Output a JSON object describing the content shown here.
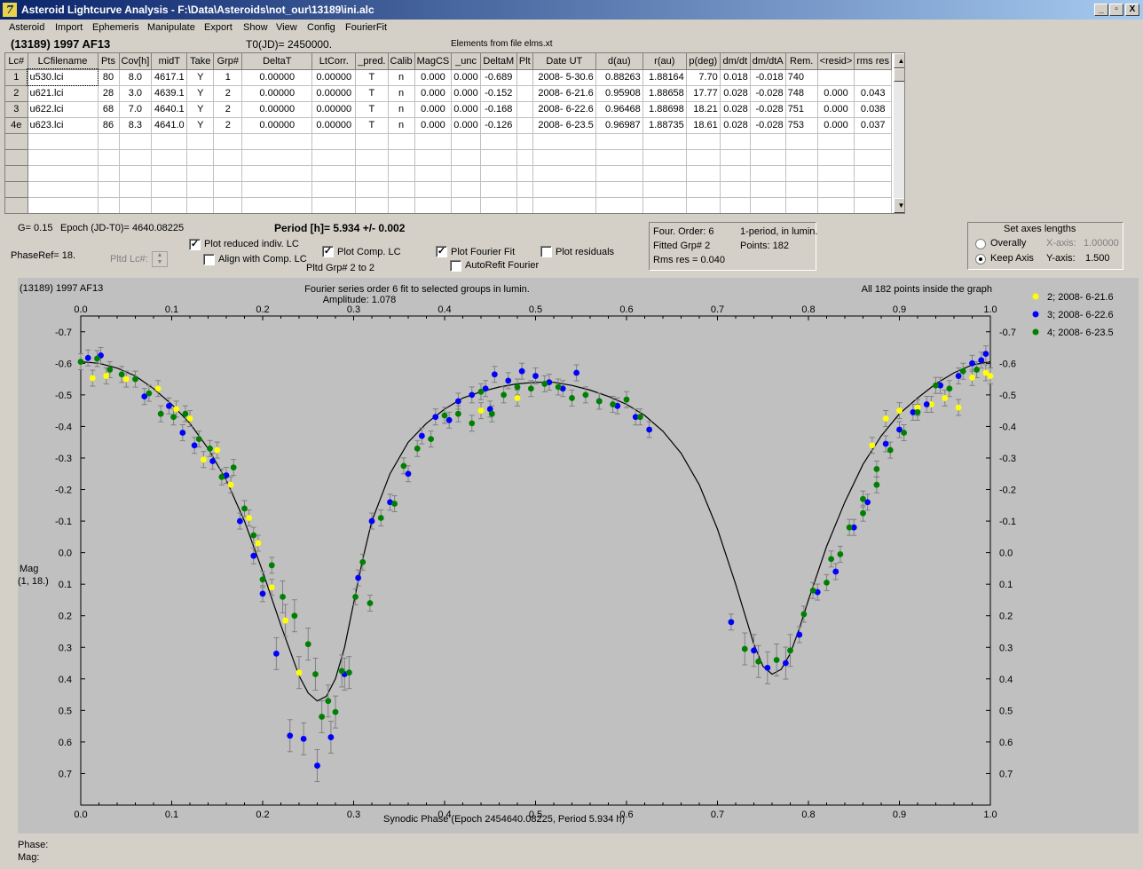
{
  "window": {
    "title": "Asteroid Lightcurve Analysis - F:\\Data\\Asteroids\\not_our\\13189\\ini.alc",
    "app_icon_glyph": "7",
    "controls": [
      "_",
      "▫",
      "X"
    ]
  },
  "menu": [
    "Asteroid",
    "Import",
    "Ephemeris",
    "Manipulate",
    "Export",
    "Show",
    "View",
    "Config",
    "FourierFit"
  ],
  "header": {
    "asteroid": "(13189) 1997 AF13",
    "t0": "T0(JD)= 2450000.",
    "elements": "Elements from file elms.xt"
  },
  "table": {
    "columns": [
      "Lc#",
      "LCfilename",
      "Pts",
      "Cov[h]",
      "midT",
      "Take",
      "Grp#",
      "DeltaT",
      "LtCorr.",
      "_pred.",
      "Calib",
      "MagCS",
      "_unc",
      "DeltaM",
      "Plt",
      "Date UT",
      "d(au)",
      "r(au)",
      "p(deg)",
      "dm/dt",
      "dm/dtA",
      "Rem.",
      "<resid>",
      "rms res"
    ],
    "rows": [
      [
        "1",
        "u530.lci",
        "80",
        "8.0",
        "4617.1",
        "Y",
        "1",
        "0.00000",
        "0.00000",
        "T",
        "n",
        "0.000",
        "0.000",
        "-0.689",
        "",
        "2008- 5-30.6",
        "0.88263",
        "1.88164",
        "7.70",
        "0.018",
        "-0.018",
        "740",
        "",
        ""
      ],
      [
        "2",
        "u621.lci",
        "28",
        "3.0",
        "4639.1",
        "Y",
        "2",
        "0.00000",
        "0.00000",
        "T",
        "n",
        "0.000",
        "0.000",
        "-0.152",
        "",
        "2008- 6-21.6",
        "0.95908",
        "1.88658",
        "17.77",
        "0.028",
        "-0.028",
        "748",
        "0.000",
        "0.043"
      ],
      [
        "3",
        "u622.lci",
        "68",
        "7.0",
        "4640.1",
        "Y",
        "2",
        "0.00000",
        "0.00000",
        "T",
        "n",
        "0.000",
        "0.000",
        "-0.168",
        "",
        "2008- 6-22.6",
        "0.96468",
        "1.88698",
        "18.21",
        "0.028",
        "-0.028",
        "751",
        "0.000",
        "0.038"
      ],
      [
        "4e",
        "u623.lci",
        "86",
        "8.3",
        "4641.0",
        "Y",
        "2",
        "0.00000",
        "0.00000",
        "T",
        "n",
        "0.000",
        "0.000",
        "-0.126",
        "",
        "2008- 6-23.5",
        "0.96987",
        "1.88735",
        "18.61",
        "0.028",
        "-0.028",
        "753",
        "0.000",
        "0.037"
      ]
    ],
    "empty_rows": 5
  },
  "controls": {
    "g_value": "G= 0.15",
    "epoch": "Epoch (JD-T0)= 4640.08225",
    "period": "Period [h]= 5.934 +/- 0.002",
    "phase_ref": "PhaseRef= 18.",
    "pltd_lc": "Pltd Lc#:",
    "pltd_grp": "Pltd Grp#  2  to  2",
    "plot_reduced": "Plot reduced indiv. LC",
    "align_comp": "Align with Comp. LC",
    "plot_comp": "Plot Comp. LC",
    "plot_fourier": "Plot Fourier Fit",
    "autorefit": "AutoRefit Fourier",
    "plot_residuals": "Plot residuals",
    "checked_mark": "✓",
    "plot_reduced_checked": true,
    "align_comp_checked": false,
    "plot_comp_checked": true,
    "plot_fourier_checked": true,
    "autorefit_checked": false,
    "plot_residuals_checked": false
  },
  "fit_info": {
    "four_order": "Four. Order:  6",
    "period_mode": "1-period, in lumin.",
    "fitted_grp": "Fitted Grp# 2",
    "points": "Points: 182",
    "rms": "Rms res     = 0.040"
  },
  "axes_box": {
    "title": "Set axes lengths",
    "overally": "Overally",
    "keep_axis": "Keep Axis",
    "x_label": "X-axis:",
    "x_value": "1.00000",
    "y_label": "Y-axis:",
    "y_value": "1.500",
    "selected": "Keep Axis"
  },
  "status": {
    "phase": "Phase:",
    "mag": "Mag:"
  },
  "chart_data": {
    "type": "scatter",
    "title_left": "(13189) 1997 AF13",
    "title_center": "Fourier series order 6 fit to selected groups in lumin.",
    "amplitude": "Amplitude: 1.078",
    "title_right": "All 182 points inside the graph",
    "xlabel": "Synodic Phase (Epoch 2454640.08225, Period 5.934 h)",
    "ylabel": "Mag",
    "ylabel2": "(1, 18.)",
    "xlim": [
      0,
      1
    ],
    "ylim": [
      -0.75,
      0.8
    ],
    "y_inverted": true,
    "x_ticks": [
      "0.0",
      "0.1",
      "0.2",
      "0.3",
      "0.4",
      "0.5",
      "0.6",
      "0.7",
      "0.8",
      "0.9",
      "1.0"
    ],
    "y_ticks": [
      "-0.7",
      "-0.6",
      "-0.5",
      "-0.4",
      "-0.3",
      "-0.2",
      "-0.1",
      "0.0",
      "0.1",
      "0.2",
      "0.3",
      "0.4",
      "0.5",
      "0.6",
      "0.7"
    ],
    "plot_bg": "#c0c0c0",
    "series": [
      {
        "name": "2; 2008- 6-21.6",
        "color": "#ffff00",
        "points": [
          [
            0.013,
            -0.553
          ],
          [
            0.028,
            -0.56
          ],
          [
            0.05,
            -0.55
          ],
          [
            0.085,
            -0.52
          ],
          [
            0.105,
            -0.455
          ],
          [
            0.12,
            -0.425
          ],
          [
            0.135,
            -0.295
          ],
          [
            0.15,
            -0.325
          ],
          [
            0.165,
            -0.215
          ],
          [
            0.185,
            -0.11
          ],
          [
            0.195,
            -0.03
          ],
          [
            0.21,
            0.11
          ],
          [
            0.225,
            0.215
          ],
          [
            0.24,
            0.38
          ],
          [
            0.885,
            -0.425
          ],
          [
            0.9,
            -0.45
          ],
          [
            0.92,
            -0.46
          ],
          [
            0.935,
            -0.47
          ],
          [
            0.95,
            -0.49
          ],
          [
            0.965,
            -0.46
          ],
          [
            0.98,
            -0.555
          ],
          [
            0.995,
            -0.57
          ],
          [
            1.0,
            -0.56
          ],
          [
            0.44,
            -0.45
          ],
          [
            0.87,
            -0.34
          ],
          [
            0.48,
            -0.49
          ]
        ]
      },
      {
        "name": "3; 2008- 6-22.6",
        "color": "#0000ff",
        "points": [
          [
            0.008,
            -0.617
          ],
          [
            0.022,
            -0.625
          ],
          [
            0.07,
            -0.495
          ],
          [
            0.097,
            -0.465
          ],
          [
            0.112,
            -0.38
          ],
          [
            0.125,
            -0.34
          ],
          [
            0.145,
            -0.29
          ],
          [
            0.16,
            -0.245
          ],
          [
            0.175,
            -0.1
          ],
          [
            0.19,
            0.01
          ],
          [
            0.2,
            0.13
          ],
          [
            0.215,
            0.32
          ],
          [
            0.23,
            0.58
          ],
          [
            0.245,
            0.59
          ],
          [
            0.26,
            0.675
          ],
          [
            0.275,
            0.585
          ],
          [
            0.29,
            0.385
          ],
          [
            0.305,
            0.08
          ],
          [
            0.32,
            -0.1
          ],
          [
            0.34,
            -0.16
          ],
          [
            0.36,
            -0.25
          ],
          [
            0.375,
            -0.37
          ],
          [
            0.39,
            -0.43
          ],
          [
            0.405,
            -0.42
          ],
          [
            0.415,
            -0.48
          ],
          [
            0.43,
            -0.5
          ],
          [
            0.445,
            -0.52
          ],
          [
            0.455,
            -0.565
          ],
          [
            0.47,
            -0.545
          ],
          [
            0.485,
            -0.575
          ],
          [
            0.5,
            -0.56
          ],
          [
            0.515,
            -0.54
          ],
          [
            0.53,
            -0.52
          ],
          [
            0.545,
            -0.57
          ],
          [
            0.57,
            -0.48
          ],
          [
            0.59,
            -0.465
          ],
          [
            0.61,
            -0.43
          ],
          [
            0.625,
            -0.39
          ],
          [
            0.715,
            0.22
          ],
          [
            0.74,
            0.31
          ],
          [
            0.755,
            0.365
          ],
          [
            0.775,
            0.35
          ],
          [
            0.79,
            0.26
          ],
          [
            0.81,
            0.125
          ],
          [
            0.83,
            0.06
          ],
          [
            0.85,
            -0.08
          ],
          [
            0.865,
            -0.16
          ],
          [
            0.885,
            -0.345
          ],
          [
            0.9,
            -0.39
          ],
          [
            0.915,
            -0.445
          ],
          [
            0.93,
            -0.47
          ],
          [
            0.945,
            -0.53
          ],
          [
            0.965,
            -0.56
          ],
          [
            0.98,
            -0.6
          ],
          [
            0.995,
            -0.63
          ],
          [
            0.99,
            -0.61
          ],
          [
            0.45,
            -0.455
          ]
        ]
      },
      {
        "name": "4; 2008- 6-23.5",
        "color": "#008000",
        "points": [
          [
            0.0,
            -0.605
          ],
          [
            0.018,
            -0.615
          ],
          [
            0.032,
            -0.58
          ],
          [
            0.045,
            -0.565
          ],
          [
            0.06,
            -0.55
          ],
          [
            0.075,
            -0.505
          ],
          [
            0.088,
            -0.44
          ],
          [
            0.102,
            -0.43
          ],
          [
            0.115,
            -0.44
          ],
          [
            0.13,
            -0.36
          ],
          [
            0.142,
            -0.33
          ],
          [
            0.155,
            -0.24
          ],
          [
            0.168,
            -0.27
          ],
          [
            0.18,
            -0.14
          ],
          [
            0.19,
            -0.055
          ],
          [
            0.2,
            0.085
          ],
          [
            0.21,
            0.04
          ],
          [
            0.222,
            0.14
          ],
          [
            0.235,
            0.2
          ],
          [
            0.25,
            0.29
          ],
          [
            0.258,
            0.385
          ],
          [
            0.265,
            0.52
          ],
          [
            0.272,
            0.47
          ],
          [
            0.28,
            0.505
          ],
          [
            0.287,
            0.375
          ],
          [
            0.295,
            0.38
          ],
          [
            0.302,
            0.14
          ],
          [
            0.31,
            0.03
          ],
          [
            0.318,
            0.16
          ],
          [
            0.33,
            -0.11
          ],
          [
            0.345,
            -0.155
          ],
          [
            0.355,
            -0.275
          ],
          [
            0.37,
            -0.33
          ],
          [
            0.385,
            -0.36
          ],
          [
            0.4,
            -0.435
          ],
          [
            0.415,
            -0.44
          ],
          [
            0.43,
            -0.41
          ],
          [
            0.44,
            -0.51
          ],
          [
            0.452,
            -0.44
          ],
          [
            0.465,
            -0.5
          ],
          [
            0.48,
            -0.525
          ],
          [
            0.495,
            -0.52
          ],
          [
            0.51,
            -0.535
          ],
          [
            0.525,
            -0.525
          ],
          [
            0.54,
            -0.49
          ],
          [
            0.555,
            -0.5
          ],
          [
            0.57,
            -0.48
          ],
          [
            0.585,
            -0.47
          ],
          [
            0.6,
            -0.485
          ],
          [
            0.615,
            -0.43
          ],
          [
            0.73,
            0.305
          ],
          [
            0.745,
            0.345
          ],
          [
            0.765,
            0.34
          ],
          [
            0.78,
            0.31
          ],
          [
            0.795,
            0.195
          ],
          [
            0.805,
            0.12
          ],
          [
            0.82,
            0.095
          ],
          [
            0.835,
            0.005
          ],
          [
            0.845,
            -0.08
          ],
          [
            0.86,
            -0.125
          ],
          [
            0.875,
            -0.215
          ],
          [
            0.89,
            -0.325
          ],
          [
            0.905,
            -0.38
          ],
          [
            0.92,
            -0.445
          ],
          [
            0.94,
            -0.53
          ],
          [
            0.955,
            -0.52
          ],
          [
            0.97,
            -0.575
          ],
          [
            0.985,
            -0.58
          ],
          [
            0.86,
            -0.17
          ],
          [
            0.875,
            -0.265
          ],
          [
            0.825,
            0.02
          ]
        ]
      }
    ],
    "fourier_curve": [
      [
        0.0,
        -0.605
      ],
      [
        0.02,
        -0.6
      ],
      [
        0.04,
        -0.585
      ],
      [
        0.06,
        -0.56
      ],
      [
        0.08,
        -0.52
      ],
      [
        0.1,
        -0.47
      ],
      [
        0.12,
        -0.41
      ],
      [
        0.14,
        -0.33
      ],
      [
        0.16,
        -0.23
      ],
      [
        0.18,
        -0.1
      ],
      [
        0.2,
        0.06
      ],
      [
        0.22,
        0.23
      ],
      [
        0.24,
        0.39
      ],
      [
        0.25,
        0.445
      ],
      [
        0.26,
        0.47
      ],
      [
        0.27,
        0.455
      ],
      [
        0.28,
        0.4
      ],
      [
        0.29,
        0.3
      ],
      [
        0.3,
        0.16
      ],
      [
        0.31,
        0.02
      ],
      [
        0.32,
        -0.1
      ],
      [
        0.34,
        -0.25
      ],
      [
        0.36,
        -0.35
      ],
      [
        0.38,
        -0.41
      ],
      [
        0.4,
        -0.455
      ],
      [
        0.42,
        -0.49
      ],
      [
        0.44,
        -0.51
      ],
      [
        0.46,
        -0.525
      ],
      [
        0.48,
        -0.535
      ],
      [
        0.5,
        -0.54
      ],
      [
        0.52,
        -0.54
      ],
      [
        0.54,
        -0.53
      ],
      [
        0.56,
        -0.515
      ],
      [
        0.58,
        -0.495
      ],
      [
        0.6,
        -0.47
      ],
      [
        0.62,
        -0.435
      ],
      [
        0.64,
        -0.385
      ],
      [
        0.66,
        -0.315
      ],
      [
        0.68,
        -0.215
      ],
      [
        0.7,
        -0.075
      ],
      [
        0.72,
        0.1
      ],
      [
        0.74,
        0.29
      ],
      [
        0.75,
        0.36
      ],
      [
        0.76,
        0.385
      ],
      [
        0.77,
        0.37
      ],
      [
        0.78,
        0.32
      ],
      [
        0.79,
        0.24
      ],
      [
        0.8,
        0.15
      ],
      [
        0.82,
        -0.02
      ],
      [
        0.84,
        -0.16
      ],
      [
        0.86,
        -0.28
      ],
      [
        0.88,
        -0.37
      ],
      [
        0.9,
        -0.44
      ],
      [
        0.92,
        -0.49
      ],
      [
        0.94,
        -0.535
      ],
      [
        0.96,
        -0.57
      ],
      [
        0.98,
        -0.595
      ],
      [
        1.0,
        -0.605
      ]
    ],
    "legend_placement": "top-right outside"
  }
}
